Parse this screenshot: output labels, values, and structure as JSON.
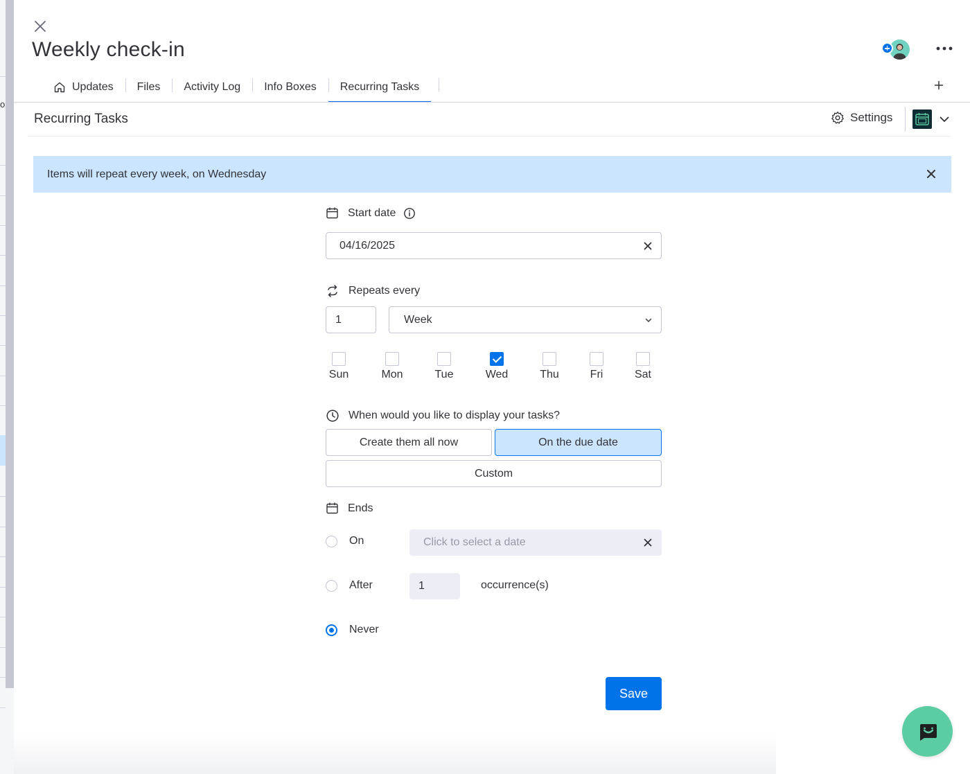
{
  "item": {
    "title": "Weekly check-in"
  },
  "tabs": [
    {
      "label": "Updates"
    },
    {
      "label": "Files"
    },
    {
      "label": "Activity Log"
    },
    {
      "label": "Info Boxes"
    },
    {
      "label": "Recurring Tasks"
    }
  ],
  "section": {
    "title": "Recurring Tasks",
    "settings_label": "Settings"
  },
  "banner": {
    "text": "Items will repeat every week, on Wednesday"
  },
  "start_date": {
    "label": "Start date",
    "value": "04/16/2025"
  },
  "repeats": {
    "label": "Repeats every",
    "interval": "1",
    "unit": "Week",
    "days": [
      {
        "label": "Sun",
        "checked": false
      },
      {
        "label": "Mon",
        "checked": false
      },
      {
        "label": "Tue",
        "checked": false
      },
      {
        "label": "Wed",
        "checked": true
      },
      {
        "label": "Thu",
        "checked": false
      },
      {
        "label": "Fri",
        "checked": false
      },
      {
        "label": "Sat",
        "checked": false
      }
    ]
  },
  "display": {
    "question": "When would you like to display your tasks?",
    "options": [
      {
        "label": "Create them all now",
        "selected": false
      },
      {
        "label": "On the due date",
        "selected": true
      },
      {
        "label": "Custom",
        "selected": false
      }
    ]
  },
  "ends": {
    "label": "Ends",
    "on_label": "On",
    "on_placeholder": "Click to select a date",
    "after_label": "After",
    "after_value": "1",
    "occurrences_label": "occurrence(s)",
    "never_label": "Never",
    "selected": "never"
  },
  "actions": {
    "save_label": "Save"
  },
  "background": {
    "cut_text": "o"
  },
  "colors": {
    "accent": "#0073ea",
    "banner": "#cce5ff",
    "fab": "#5ccda3"
  }
}
